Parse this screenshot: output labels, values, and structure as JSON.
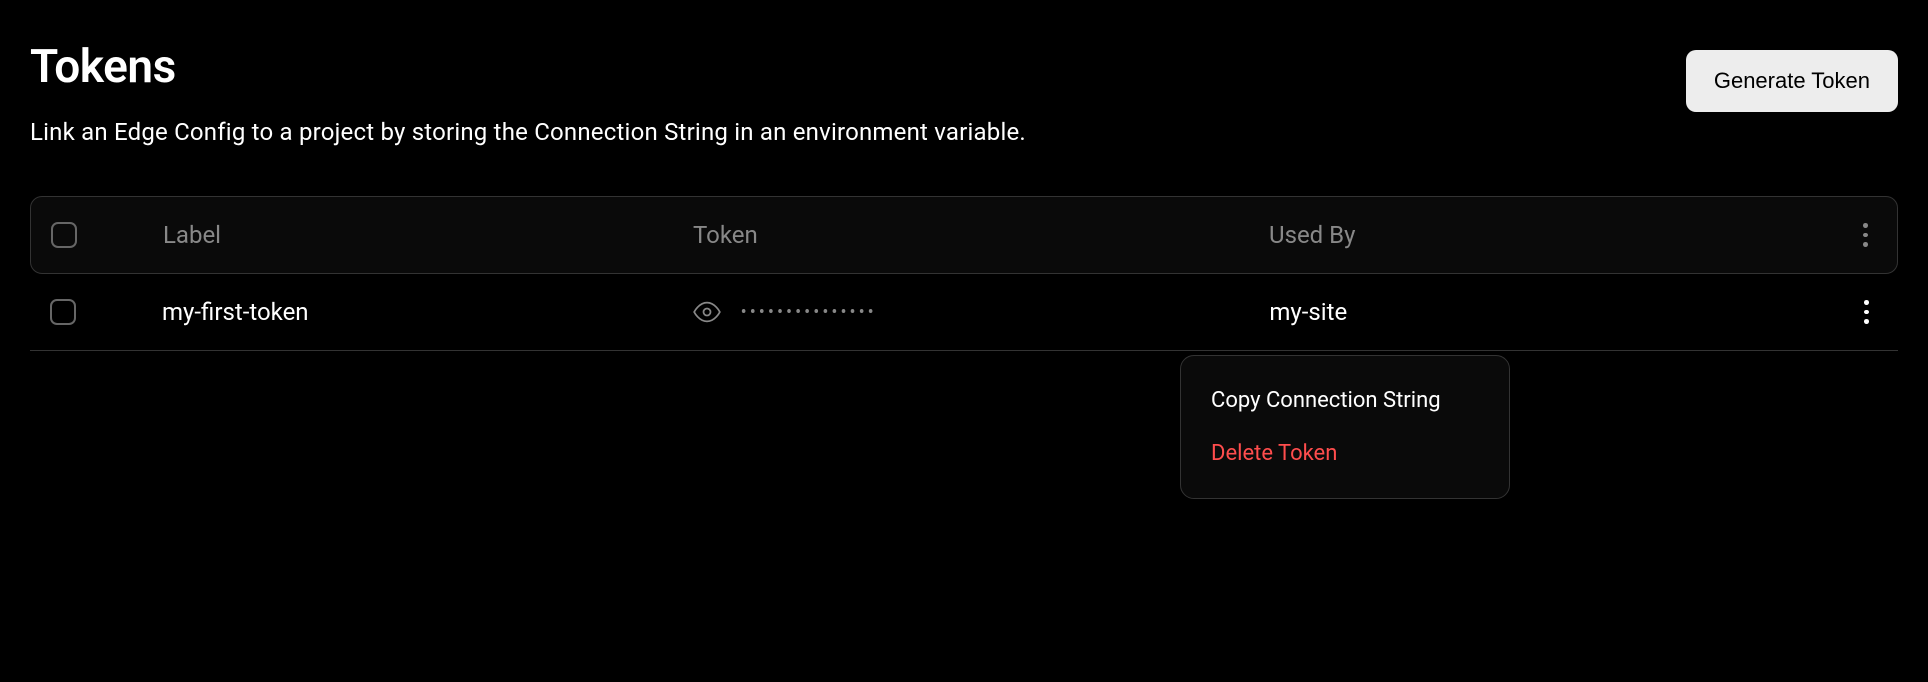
{
  "header": {
    "title": "Tokens",
    "subtitle": "Link an Edge Config to a project by storing the Connection String in an environment variable.",
    "generate_button_label": "Generate Token"
  },
  "table": {
    "columns": {
      "label": "Label",
      "token": "Token",
      "used_by": "Used By"
    },
    "rows": [
      {
        "label": "my-first-token",
        "token_masked": "•••••••••••••••",
        "used_by": "my-site"
      }
    ]
  },
  "context_menu": {
    "copy_label": "Copy Connection String",
    "delete_label": "Delete Token"
  }
}
